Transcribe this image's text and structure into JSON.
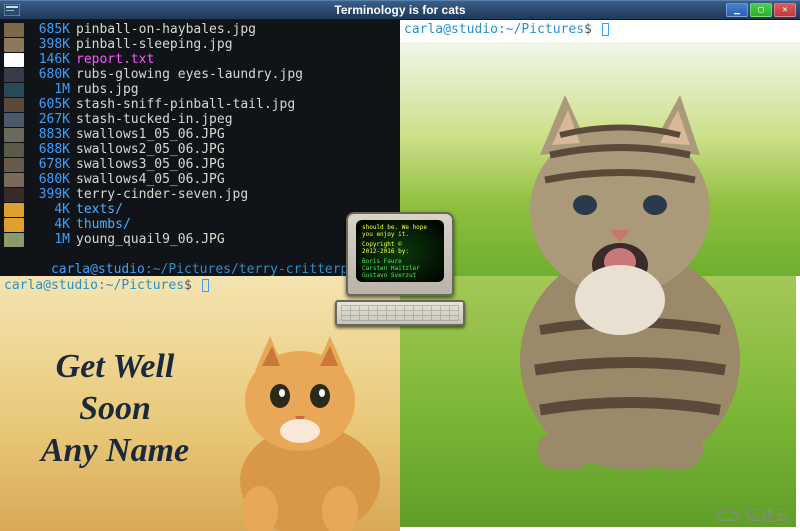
{
  "window": {
    "title": "Terminology is for cats"
  },
  "panes": {
    "tl": {
      "files": [
        {
          "size": "685K",
          "name": "pinball-on-haybales.jpg",
          "kind": "img",
          "thumb": "#7a6a4a"
        },
        {
          "size": "398K",
          "name": "pinball-sleeping.jpg",
          "kind": "img",
          "thumb": "#8a7a5a"
        },
        {
          "size": "146K",
          "name": "report.txt",
          "kind": "txt",
          "thumb": "#ffffff"
        },
        {
          "size": "680K",
          "name": "rubs-glowing eyes-laundry.jpg",
          "kind": "img",
          "thumb": "#3a3a4a"
        },
        {
          "size": "1M",
          "name": "rubs.jpg",
          "kind": "img",
          "thumb": "#2a4a5a"
        },
        {
          "size": "605K",
          "name": "stash-sniff-pinball-tail.jpg",
          "kind": "img",
          "thumb": "#5a4a3a"
        },
        {
          "size": "267K",
          "name": "stash-tucked-in.jpeg",
          "kind": "img",
          "thumb": "#4a5a6a"
        },
        {
          "size": "883K",
          "name": "swallows1_05_06.JPG",
          "kind": "img",
          "thumb": "#6a6a5a"
        },
        {
          "size": "688K",
          "name": "swallows2_05_06.JPG",
          "kind": "img",
          "thumb": "#5a5a4a"
        },
        {
          "size": "678K",
          "name": "swallows3_05_06.JPG",
          "kind": "img",
          "thumb": "#6a5a4a"
        },
        {
          "size": "680K",
          "name": "swallows4_05_06.JPG",
          "kind": "img",
          "thumb": "#7a6a5a"
        },
        {
          "size": "399K",
          "name": "terry-cinder-seven.jpg",
          "kind": "img",
          "thumb": "#3a2a2a"
        },
        {
          "size": "4K",
          "name": "texts/",
          "kind": "dir",
          "thumb": "#e0a030"
        },
        {
          "size": "4K",
          "name": "thumbs/",
          "kind": "dir",
          "thumb": "#e0a030"
        },
        {
          "size": "1M",
          "name": "young_quail9_06.JPG",
          "kind": "img",
          "thumb": "#8a9a6a"
        }
      ],
      "prompt_user": "carla@studio",
      "prompt_path": "~/Pictures/terry-critterpics",
      "prompt_sym": "$"
    },
    "bl": {
      "prompt_user": "carla@studio",
      "prompt_path": "~/Pictures",
      "prompt_sym": "$",
      "card_line1": "Get Well",
      "card_line2": "Soon",
      "card_line3": "Any Name"
    },
    "tr": {
      "prompt_user": "carla@studio",
      "prompt_path": "~/Pictures",
      "prompt_sym": "$"
    }
  },
  "about": {
    "line1": "should be. We hope",
    "line2": "you enjoy it.",
    "copyright1": "Copyright ©",
    "copyright2": "2012-2016 by:",
    "credit1": "Boris Faure",
    "credit2": "Carsten Haitzler",
    "credit3": "Gustavo Sverzut"
  },
  "watermark": "亿速云"
}
